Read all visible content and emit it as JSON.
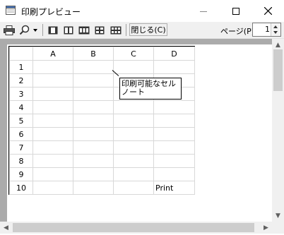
{
  "window": {
    "title": "印刷プレビュー"
  },
  "toolbar": {
    "print_icon": "printer-icon",
    "zoom_icon": "magnifier-icon",
    "layout_icons": [
      "one-page-icon",
      "two-pages-icon",
      "three-pages-icon",
      "four-pages-icon",
      "six-pages-icon"
    ],
    "close_label": "閉じる(C)",
    "page_label": "ページ(P)",
    "page_value": "1"
  },
  "sheet": {
    "columns": [
      "A",
      "B",
      "C",
      "D"
    ],
    "rows": [
      "1",
      "2",
      "3",
      "4",
      "5",
      "6",
      "7",
      "8",
      "9",
      "10"
    ],
    "cell_d10": "Print",
    "comment_line1": "印刷可能なセル",
    "comment_line2": "ノート"
  },
  "colors": {
    "preview_background": "#ababab",
    "toolbar_background": "#f0f0f0"
  }
}
